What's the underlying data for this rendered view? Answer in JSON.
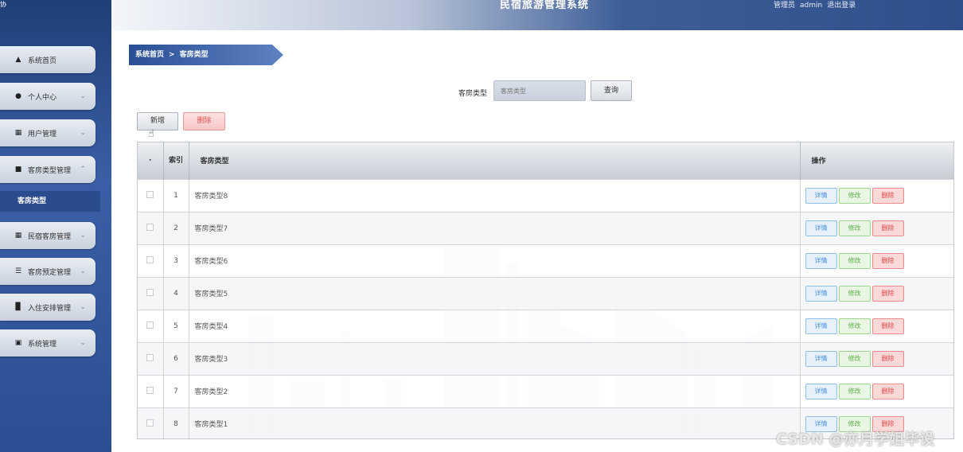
{
  "header": {
    "title": "民宿旅游管理系统",
    "user_role": "管理员",
    "username": "admin",
    "logout_label": "退出登录"
  },
  "corner_text": "协",
  "sidebar": {
    "items": [
      {
        "label": "系统首页",
        "icon": "home-icon"
      },
      {
        "label": "个人中心",
        "icon": "user-icon"
      },
      {
        "label": "用户管理",
        "icon": "grid-icon"
      },
      {
        "label": "客房类型管理",
        "icon": "comment-icon"
      },
      {
        "label": "民宿客房管理",
        "icon": "grid-icon"
      },
      {
        "label": "客房预定管理",
        "icon": "list-icon"
      },
      {
        "label": "入住安排管理",
        "icon": "bar-chart-icon"
      },
      {
        "label": "系统管理",
        "icon": "image-icon"
      }
    ],
    "sub_item": "客房类型"
  },
  "breadcrumb": {
    "home": "系统首页",
    "separator": ">",
    "current": "客房类型"
  },
  "search": {
    "label": "客房类型",
    "placeholder": "客房类型",
    "button": "查询"
  },
  "actions": {
    "add": "新增",
    "delete": "删除"
  },
  "table": {
    "headers": {
      "index": "索引",
      "name": "客房类型",
      "ops": "操作"
    },
    "ops": {
      "detail": "详情",
      "edit": "修改",
      "delete": "删除"
    },
    "rows": [
      {
        "index": "1",
        "name": "客房类型8"
      },
      {
        "index": "2",
        "name": "客房类型7"
      },
      {
        "index": "3",
        "name": "客房类型6"
      },
      {
        "index": "4",
        "name": "客房类型5"
      },
      {
        "index": "5",
        "name": "客房类型4"
      },
      {
        "index": "6",
        "name": "客房类型3"
      },
      {
        "index": "7",
        "name": "客房类型2"
      },
      {
        "index": "8",
        "name": "客房类型1"
      }
    ]
  },
  "watermark": "CSDN @亦月学姐毕设"
}
